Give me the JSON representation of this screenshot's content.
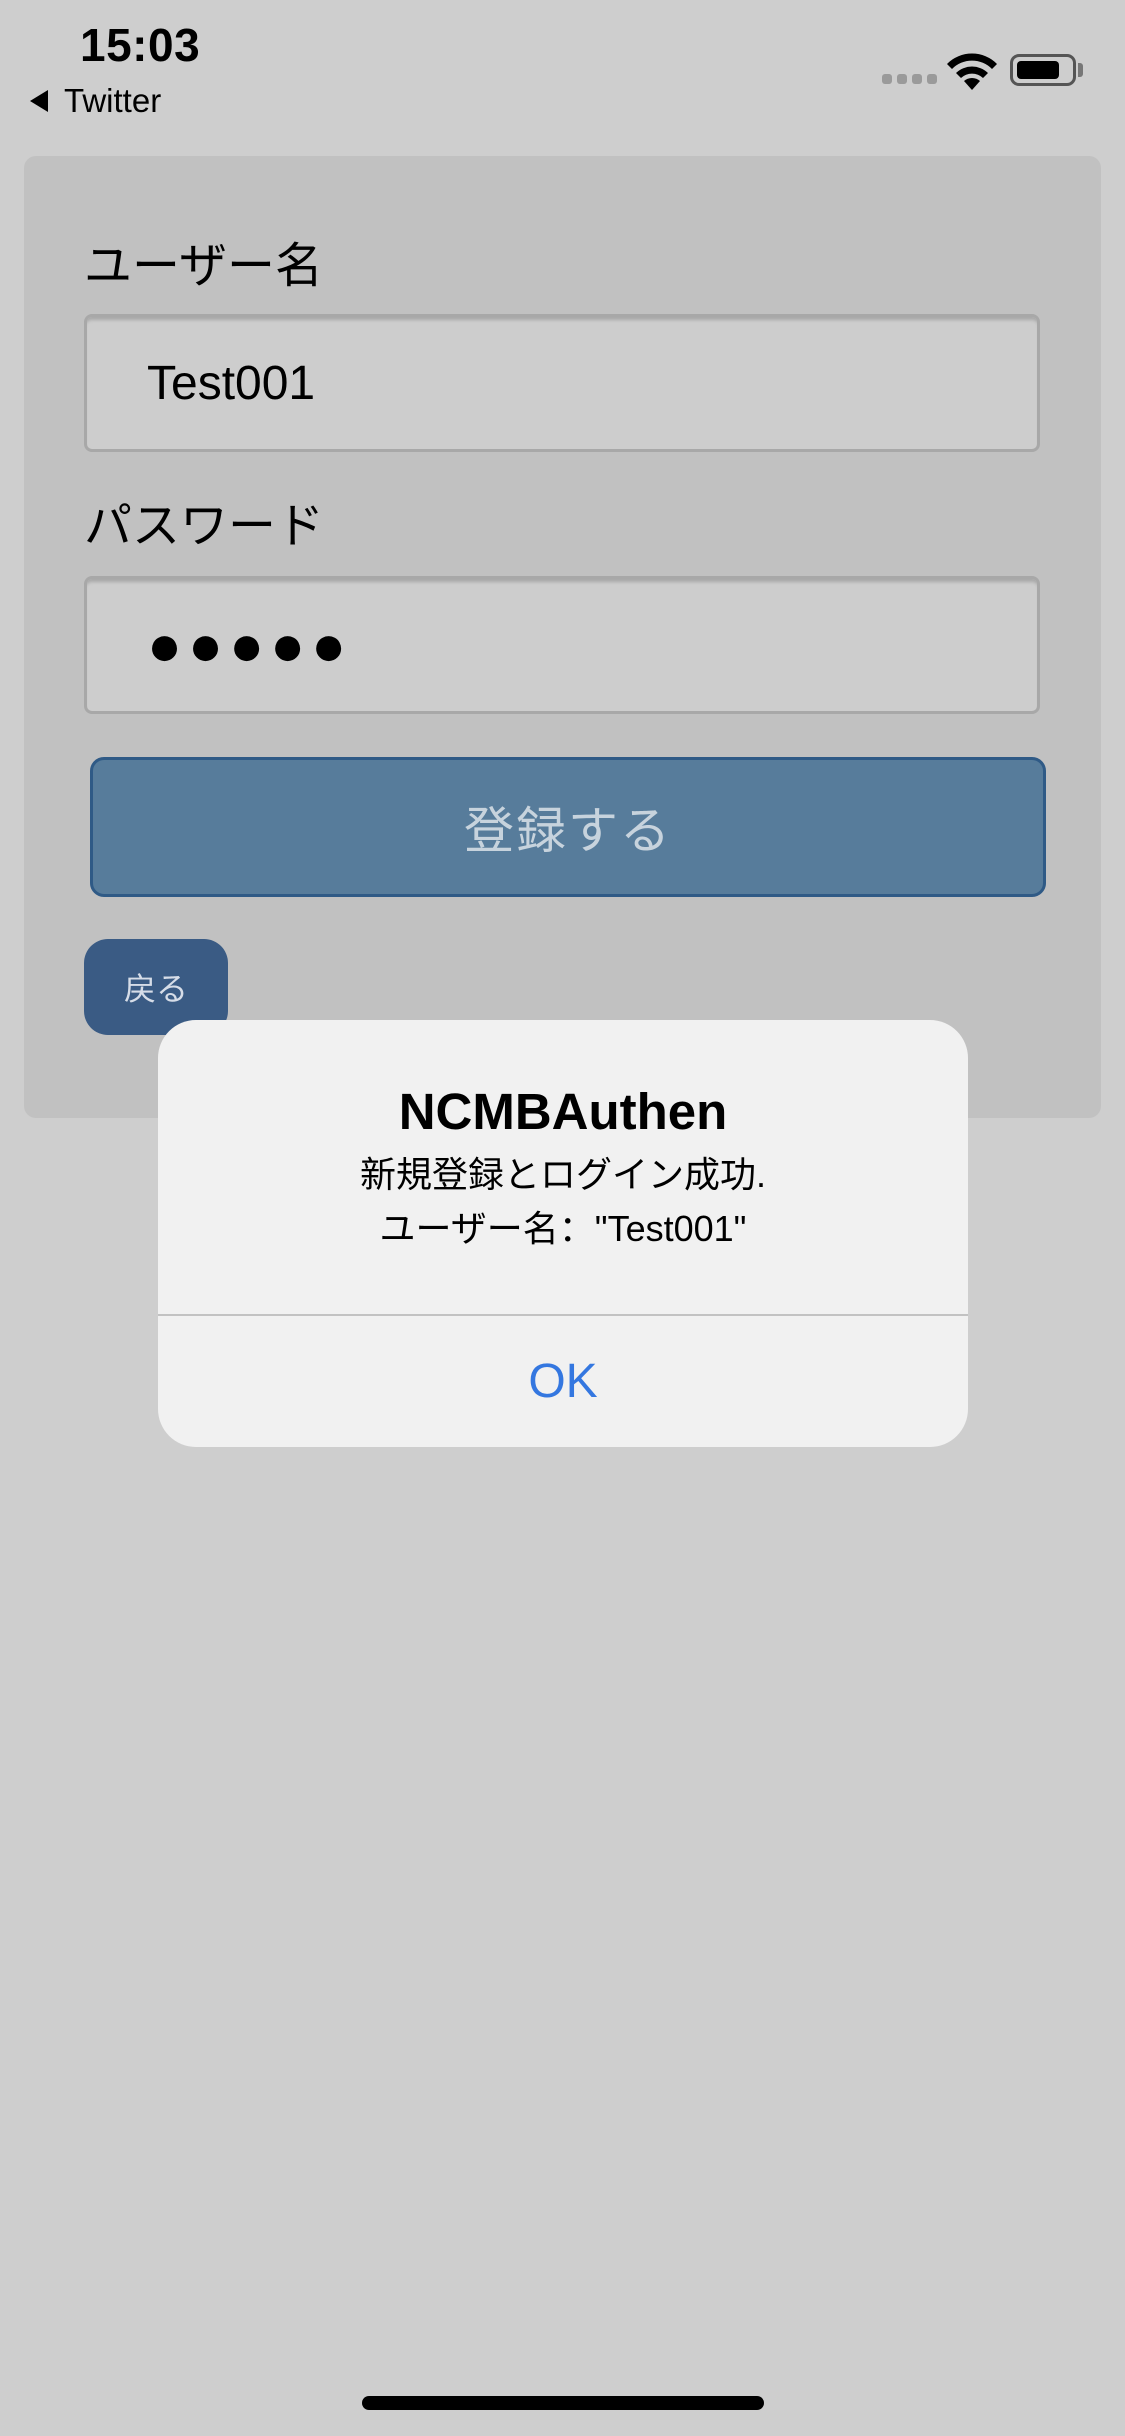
{
  "status_bar": {
    "time": "15:03",
    "back_app": "Twitter"
  },
  "form": {
    "username_label": "ユーザー名",
    "username_value": "Test001",
    "password_label": "パスワード",
    "password_value": "●●●●●",
    "register_label": "登録する",
    "back_label": "戻る"
  },
  "alert": {
    "title": "NCMBAuthen",
    "message_line1": "新規登録とログイン成功.",
    "message_line2": "ユーザー名：\"Test001\"",
    "ok_label": "OK"
  },
  "colors": {
    "background": "#cecece",
    "card": "#c1c1c1",
    "register_button": "#577c9b",
    "back_button": "#3a5b84",
    "alert_ok": "#3477e0"
  },
  "icons": [
    "back-triangle-icon",
    "cellular-signal-icon",
    "wifi-icon",
    "battery-icon"
  ]
}
